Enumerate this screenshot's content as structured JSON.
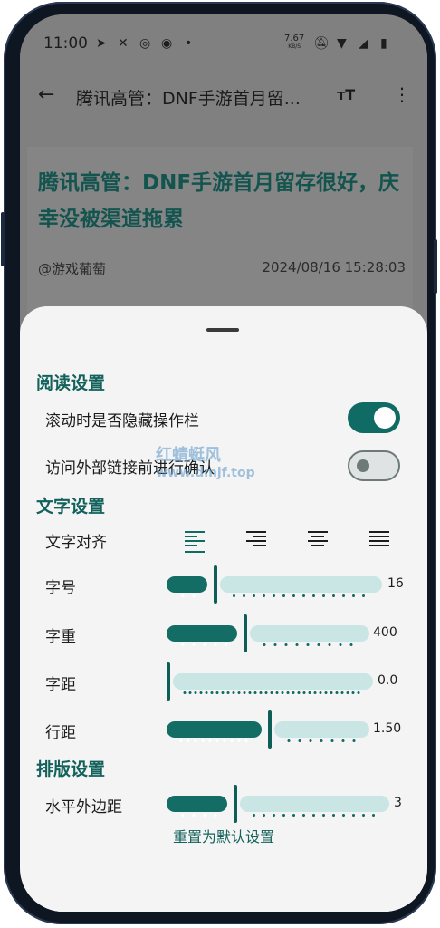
{
  "status_bar": {
    "time": "11:00",
    "left_icons": [
      "telegram-icon",
      "x-icon",
      "instagram-icon",
      "threads-icon",
      "dot-icon"
    ],
    "net_speed": "7.67",
    "net_unit": "KB/S",
    "right_icons": [
      "mute-icon",
      "wifi-icon",
      "signal-icon",
      "battery-icon"
    ]
  },
  "app_bar": {
    "back_icon": "arrow-back-icon",
    "title": "腾讯高管：DNF手游首月留...",
    "text_size_icon": "тT",
    "more_icon": "⋮"
  },
  "article": {
    "title": "腾讯高管：DNF手游首月留存很好，庆幸没被渠道拖累",
    "author": "@游戏葡萄",
    "date": "2024/08/16 15:28:03"
  },
  "sheet": {
    "reading_title": "阅读设置",
    "hide_toolbar_label": "滚动时是否隐藏操作栏",
    "hide_toolbar_on": true,
    "confirm_link_label": "访问外部链接前进行确认",
    "confirm_link_on": false,
    "text_title": "文字设置",
    "align_label": "文字对齐",
    "align_options": [
      "align-left-icon",
      "align-right-icon",
      "align-center-icon",
      "align-justify-icon"
    ],
    "align_selected": "align-left-icon",
    "font_size": {
      "label": "字号",
      "value": "16",
      "fraction": 0.22
    },
    "font_weight": {
      "label": "字重",
      "value": "400",
      "fraction": 0.38
    },
    "letter_spacing": {
      "label": "字距",
      "value": "0.0",
      "fraction": 0.0
    },
    "line_height": {
      "label": "行距",
      "value": "1.50",
      "fraction": 0.5
    },
    "layout_title": "排版设置",
    "horizontal_margin": {
      "label": "水平外边距",
      "value": "3",
      "fraction": 0.3
    },
    "reset_label": "重置为默认设置"
  },
  "watermark": {
    "line1": "红蜻蜓风",
    "line2": "www.dmjf.top"
  },
  "colors": {
    "accent": "#12615b",
    "slider_fill": "#146d65",
    "slider_track": "#c9e6e4",
    "sheet_bg": "#f4f4f4"
  }
}
